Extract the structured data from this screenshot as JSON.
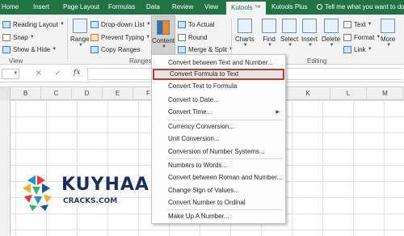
{
  "tabs": [
    {
      "label": "Home"
    },
    {
      "label": "Insert"
    },
    {
      "label": "Page Layout"
    },
    {
      "label": "Formulas"
    },
    {
      "label": "Data"
    },
    {
      "label": "Review"
    },
    {
      "label": "View"
    },
    {
      "label": "Kutools ™"
    },
    {
      "label": "Kutools Plus"
    },
    {
      "label": "Tell me what you want to do"
    }
  ],
  "ribbon": {
    "view_group": {
      "reading_layout": "Reading Layout",
      "snap": "Snap",
      "show_hide": "Show & Hide",
      "label": "View"
    },
    "range_group": {
      "range": "Range",
      "drop_down_list": "Drop-down List",
      "prevent_typing": "Prevent Typing",
      "copy_ranges": "Copy Ranges",
      "content": "Content",
      "to_actual": "To Actual",
      "round": "Round",
      "merge_split": "Merge & Split",
      "label": "Ranges &"
    },
    "editing_group": {
      "charts": "Charts",
      "find": "Find",
      "select": "Select",
      "insert": "Insert",
      "delete": "Delete",
      "text": "Text",
      "format": "Format",
      "link": "Link",
      "more": "More",
      "label": "Editing"
    }
  },
  "formula_bar": {
    "fx": "fx",
    "cancel": "✕",
    "enter": "✓",
    "value": ""
  },
  "columns": [
    "B",
    "C",
    "D",
    "E",
    "F",
    "K",
    "L",
    "M"
  ],
  "menu": {
    "items": [
      {
        "label": "Convert between Text and Number..."
      },
      {
        "label": "Convert Formula to Text"
      },
      {
        "label": "Convert Text to Formula"
      },
      {
        "label": "Convert to Date..."
      },
      {
        "label": "Convert Time..."
      },
      {
        "label": "Currency Conversion..."
      },
      {
        "label": "Unit Conversion..."
      },
      {
        "label": "Conversion of Number Systems..."
      },
      {
        "label": "Numbers to Words..."
      },
      {
        "label": "Convert between Roman and Number..."
      },
      {
        "label": "Change Sign of Values..."
      },
      {
        "label": "Convert Number to Ordinal"
      },
      {
        "label": "Make Up A Number..."
      }
    ],
    "highlighted_index": 1
  },
  "watermark": {
    "word": "KUYHAA",
    "sub": "CRACKS.COM"
  },
  "colors": {
    "accent": "#217346",
    "highlight_border": "#c0383a"
  }
}
